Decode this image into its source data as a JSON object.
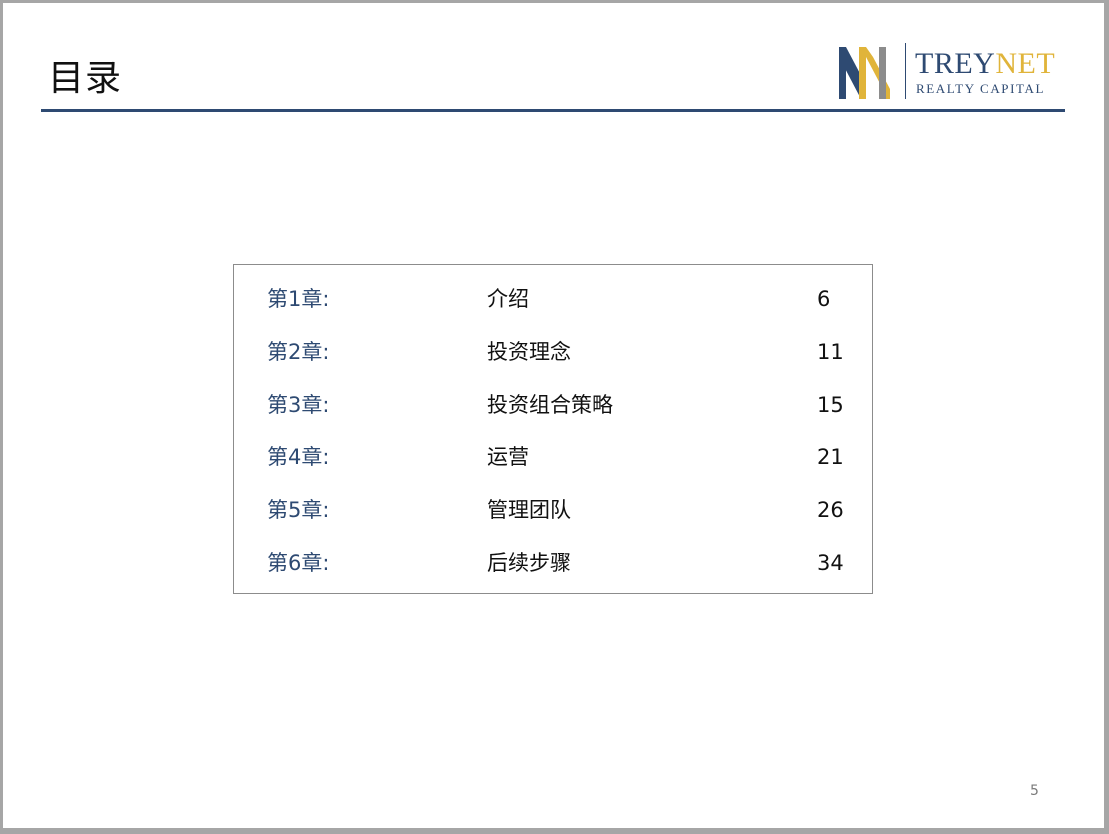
{
  "slide": {
    "title": "目录",
    "page_number": "5"
  },
  "logo": {
    "word_part1": "TREY",
    "word_part2": "NET",
    "subtitle": "REALTY CAPITAL",
    "colors": {
      "navy": "#2e4a72",
      "gold": "#e0b43a",
      "gray": "#8c8c8c"
    }
  },
  "toc": {
    "rows": [
      {
        "chapter": "第1章:",
        "label": "介绍",
        "page": "6"
      },
      {
        "chapter": "第2章:",
        "label": "投资理念",
        "page": "11"
      },
      {
        "chapter": "第3章:",
        "label": "投资组合策略",
        "page": "15"
      },
      {
        "chapter": "第4章:",
        "label": "运营",
        "page": "21"
      },
      {
        "chapter": "第5章:",
        "label": "管理团队",
        "page": "26"
      },
      {
        "chapter": "第6章:",
        "label": "后续步骤",
        "page": "34"
      }
    ]
  },
  "colors": {
    "accent": "#2e4a72",
    "border": "#8c8c8c",
    "text": "#111111"
  }
}
